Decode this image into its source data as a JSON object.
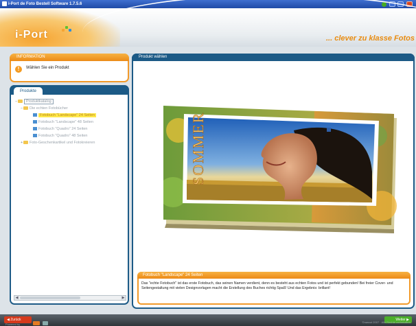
{
  "window": {
    "title": "i-Port de Foto Bestell Software 1.7.5.6"
  },
  "header": {
    "logo_text": "i-Port",
    "slogan": "... clever zu klasse Fotos"
  },
  "info_panel": {
    "title": "INFORMATION",
    "message": "Wählen Sie ein Produkt"
  },
  "products_panel": {
    "tab_label": "Produkte",
    "tree": {
      "root": "Produktkatalog",
      "group1": "Die echten Fotobücher",
      "items": [
        {
          "label": "Fotobuch \"Landscape\" 24 Seiten",
          "selected": true
        },
        {
          "label": "Fotobuch \"Landscape\" 48 Seiten",
          "selected": false
        },
        {
          "label": "Fotobuch \"Quadro\" 24 Seiten",
          "selected": false
        },
        {
          "label": "Fotobuch \"Quadro\" 48 Seiten",
          "selected": false
        }
      ],
      "group2": "Foto-Geschenkartikel und Fotokreieren"
    }
  },
  "product_view": {
    "title": "Produkt wählen",
    "book_cover_text": "SOMMER",
    "description_title": "Fotobuch \"Landscape\" 24 Seiten",
    "description": "Das \"echte Fotobuch\" ist das erste Fotobuch, das seinen Namen verdient, denn es besteht aus echten Fotos und ist perfekt gebunden! Bei freier Cover- und Seitengestaltung mit vielen Designvorlagen macht die Erstellung des Buches richtig Spaß! Und das Ergebnis: brillant!"
  },
  "footer": {
    "back_label": "Zurück",
    "next_label": "Weiter",
    "powered_by": "Powered by",
    "copyright": "©rawcut 2007 · Alle Rechte vorbehalten"
  },
  "colors": {
    "orange": "#f29a2a",
    "navy": "#1c5a86",
    "selection": "#ffe84a"
  }
}
